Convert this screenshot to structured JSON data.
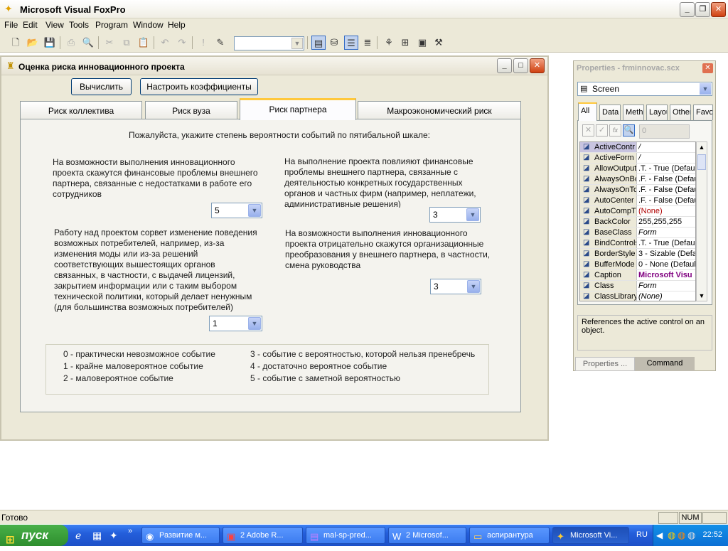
{
  "app": {
    "title": "Microsoft Visual FoxPro",
    "caption_buttons": [
      "_",
      "❐",
      "✕"
    ]
  },
  "menu": [
    "File",
    "Edit",
    "View",
    "Tools",
    "Program",
    "Window",
    "Help"
  ],
  "toolbar": {
    "combo_value": ""
  },
  "form": {
    "title": "Оценка риска инновационного проекта",
    "buttons": {
      "calculate": "Вычислить",
      "configure": "Настроить коэффициенты"
    },
    "tabs": [
      "Риск коллектива",
      "Риск вуза",
      "Риск партнера",
      "Макроэкономический риск"
    ],
    "active_tab": 2,
    "instruction": "Пожалуйста, укажите степень вероятности событий по пятибальной шкале:",
    "questions": [
      {
        "lines": [
          "На возможности выполнения инновационного",
          "проекта скажутся финансовые проблемы внешнего",
          "партнера, связанные с недостатками в работе его",
          "сотрудников"
        ],
        "value": "5"
      },
      {
        "lines": [
          "На выполнение проекта повлияют финансовые",
          "проблемы внешнего партнера, связанные с",
          "деятельностью конкретных государственных",
          "органов и частных фирм (например, неплатежи,",
          "административные решения)"
        ],
        "value": "3"
      },
      {
        "lines": [
          "Работу над проектом сорвет изменение поведения",
          "возможных потребителей, например, из-за",
          "изменения моды или из-за решений",
          "соответствующих вышестоящих органов",
          "связанных, в частности, с выдачей лицензий,",
          "закрытием информации или с таким выбором",
          "технической политики, который делает ненужным",
          "(для большинства возможных потребителей)"
        ],
        "value": "1"
      },
      {
        "lines": [
          "На возможности выполнения инновационного",
          "проекта отрицательно скажутся организационные",
          "преобразования у внешнего партнера, в частности,",
          "смена руководства"
        ],
        "value": "3"
      }
    ],
    "legend": [
      "0 - практически невозможное событие",
      "1 - крайне маловероятное событие",
      "2 - маловероятное событие",
      "3 - событие с вероятностью, которой нельзя пренебречь",
      "4 - достаточно вероятное событие",
      "5 - событие с заметной вероятностью"
    ]
  },
  "properties": {
    "title": "Properties - frminnovac.scx",
    "object": "Screen",
    "tabs": [
      "All",
      "Data",
      "Metho",
      "Layou",
      "Other",
      "Favor"
    ],
    "value_box": "0",
    "rows": [
      {
        "name": "ActiveContr",
        "value": "/"
      },
      {
        "name": "ActiveForm",
        "value": "/"
      },
      {
        "name": "AllowOutput",
        "value": ".T. - True (Defau"
      },
      {
        "name": "AlwaysOnBo",
        "value": ".F. - False (Defau"
      },
      {
        "name": "AlwaysOnTo",
        "value": ".F. - False (Defau"
      },
      {
        "name": "AutoCenter",
        "value": ".F. - False (Defau"
      },
      {
        "name": "AutoCompT",
        "value": "(None)"
      },
      {
        "name": "BackColor",
        "value": "255,255,255"
      },
      {
        "name": "BaseClass",
        "value": "Form"
      },
      {
        "name": "BindControls",
        "value": ".T. - True (Defau"
      },
      {
        "name": "BorderStyle",
        "value": "3 - Sizable (Defau"
      },
      {
        "name": "BufferMode",
        "value": "0 - None (Default"
      },
      {
        "name": "Caption",
        "value": "Microsoft Visu"
      },
      {
        "name": "Class",
        "value": "Form"
      },
      {
        "name": "ClassLibrary",
        "value": "(None)"
      }
    ],
    "description": "References the active control on an object.",
    "bottom_tabs": [
      "Properties ...",
      "Command"
    ]
  },
  "status": {
    "text": "Готово",
    "num": "NUM"
  },
  "taskbar": {
    "start": "пуск",
    "tasks": [
      "Развитие м...",
      "2 Adobe R...",
      "mal-sp-pred...",
      "2 Microsof...",
      "аспирантура",
      "Microsoft Vi..."
    ],
    "lang": "RU",
    "clock": "22:52"
  }
}
